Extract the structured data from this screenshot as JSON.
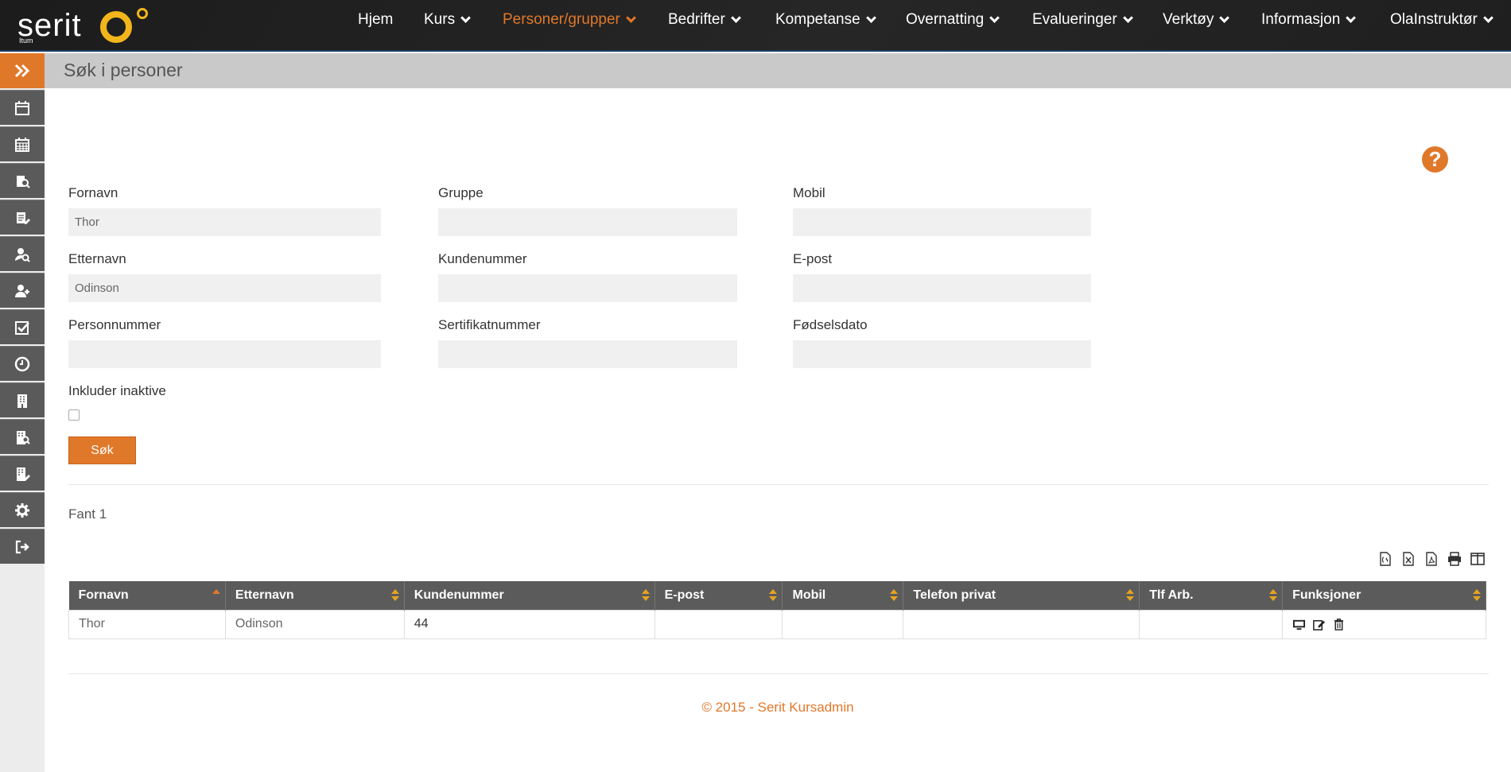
{
  "brand": {
    "logo_text": "serit",
    "logo_sub": "Itum"
  },
  "nav": [
    {
      "label": "Hjem",
      "dropdown": false
    },
    {
      "label": "Kurs",
      "dropdown": true
    },
    {
      "label": "Personer/grupper",
      "dropdown": true,
      "active": true
    },
    {
      "label": "Bedrifter",
      "dropdown": true
    },
    {
      "label": "Kompetanse",
      "dropdown": true
    },
    {
      "label": "Overnatting",
      "dropdown": true
    },
    {
      "label": "Evalueringer",
      "dropdown": true
    },
    {
      "label": "Verktøy",
      "dropdown": true
    },
    {
      "label": "Informasjon",
      "dropdown": true
    },
    {
      "label": "OlaInstruktør",
      "dropdown": true
    }
  ],
  "sidebar": {
    "toggle_icon": "double-chevron-right-icon",
    "items": [
      "calendar-icon",
      "calendar-grid-icon",
      "course-search-icon",
      "course-edit-icon",
      "person-search-icon",
      "person-add-icon",
      "checkbox-icon",
      "clock-icon",
      "building-icon",
      "building-search-icon",
      "building-edit-icon",
      "gear-icon",
      "sign-out-icon"
    ]
  },
  "page": {
    "title": "Søk i personer"
  },
  "form": {
    "fornavn_label": "Fornavn",
    "fornavn_value": "Thor",
    "gruppe_label": "Gruppe",
    "gruppe_value": "",
    "mobil_label": "Mobil",
    "mobil_value": "",
    "etternavn_label": "Etternavn",
    "etternavn_value": "Odinson",
    "kundenummer_label": "Kundenummer",
    "kundenummer_value": "",
    "epost_label": "E-post",
    "epost_value": "",
    "personnummer_label": "Personnummer",
    "personnummer_value": "",
    "sertifikat_label": "Sertifikatnummer",
    "sertifikat_value": "",
    "fodselsdato_label": "Fødselsdato",
    "fodselsdato_value": "",
    "inaktive_label": "Inkluder inaktive",
    "search_button": "Søk"
  },
  "results": {
    "found_text": "Fant 1",
    "columns": [
      "Fornavn",
      "Etternavn",
      "Kundenummer",
      "E-post",
      "Mobil",
      "Telefon privat",
      "Tlf Arb.",
      "Funksjoner"
    ],
    "rows": [
      [
        "Thor",
        "Odinson",
        "44",
        "",
        "",
        "",
        ""
      ]
    ]
  },
  "footer": {
    "text": "© 2015 - Serit Kursadmin"
  },
  "colors": {
    "accent": "#e0782a",
    "header_bg": "#5b5b5b",
    "sidebar_btn": "#5a5a5a"
  }
}
